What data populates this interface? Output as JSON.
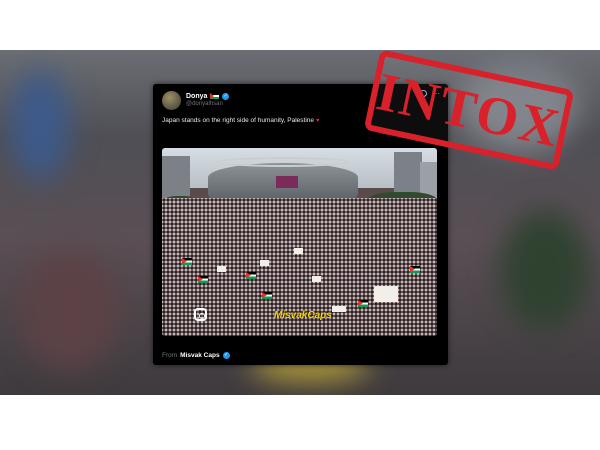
{
  "tweet": {
    "author_name": "Donya",
    "author_flag_icon": "palestine-flag-icon",
    "verified_icon": "verified-badge-icon",
    "author_handle": "@donyalhsan",
    "text": "Japan stands on the right side of humanity, Palestine",
    "text_emoji": "heart-icon",
    "media_watermark": "MisvakCaps",
    "media_social_icon": "instagram-icon",
    "from_label": "From",
    "from_source": "Misvak Caps"
  },
  "stamp": {
    "text": "INTOX",
    "color": "#d8212b"
  },
  "colors": {
    "card_bg": "#000000",
    "verified": "#1d9bf0",
    "watermark": "#ffd400"
  }
}
